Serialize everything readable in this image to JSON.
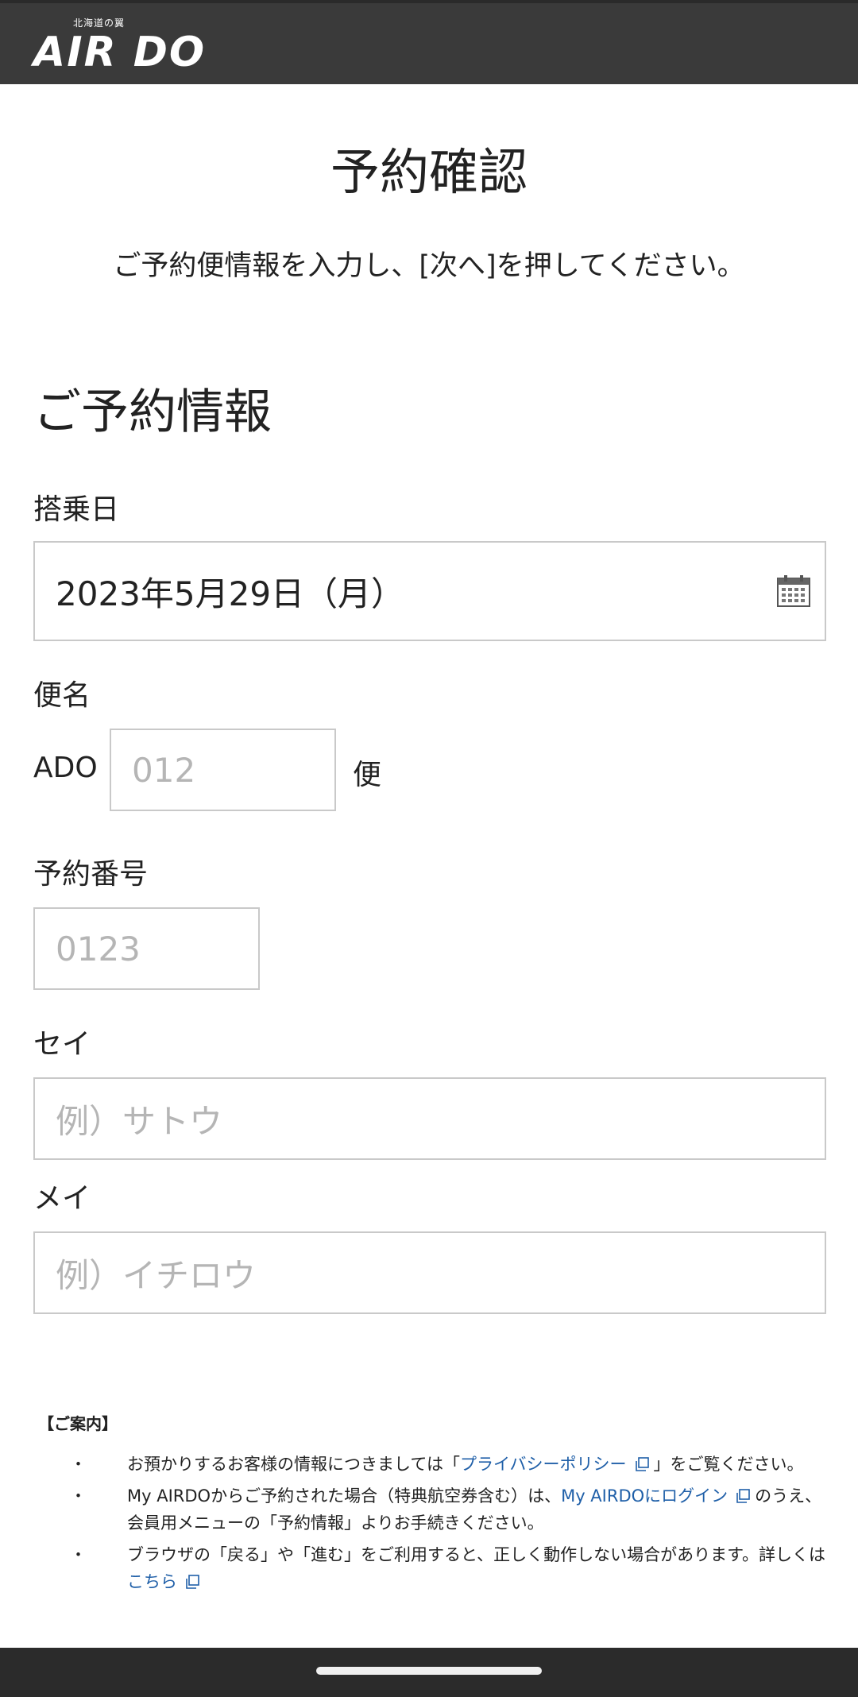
{
  "header": {
    "logo_tagline": "北海道の翼",
    "logo_text": "AIR DO"
  },
  "page": {
    "title": "予約確認",
    "instruction": "ご予約便情報を入力し、[次へ]を押してください。"
  },
  "section": {
    "title": "ご予約情報"
  },
  "form": {
    "boarding_date": {
      "label": "搭乗日",
      "value": "2023年5月29日（月）",
      "icon": "calendar-icon"
    },
    "flight_number": {
      "label": "便名",
      "prefix": "ADO",
      "placeholder": "012",
      "suffix": "便"
    },
    "reservation_number": {
      "label": "予約番号",
      "placeholder": "0123"
    },
    "sei": {
      "label": "セイ",
      "placeholder": "例）サトウ"
    },
    "mei": {
      "label": "メイ",
      "placeholder": "例）イチロウ"
    }
  },
  "notice": {
    "title": "【ご案内】",
    "items": [
      {
        "pre": "お預かりするお客様の情報につきましては「",
        "link": "プライバシーポリシー",
        "post": "」をご覧ください。"
      },
      {
        "pre": "My AIRDOからご予約された場合（特典航空券含む）は、",
        "link": "My AIRDOにログイン",
        "post": "のうえ、会員用メニューの「予約情報」よりお手続きください。"
      },
      {
        "pre": "ブラウザの「戻る」や「進む」をご利用すると、正しく動作しない場合があります。詳しくは",
        "link": "こちら",
        "post": ""
      }
    ]
  },
  "colors": {
    "header_bg": "#3a3a3a",
    "link": "#1f5fa8",
    "placeholder": "#b5b5b5"
  }
}
